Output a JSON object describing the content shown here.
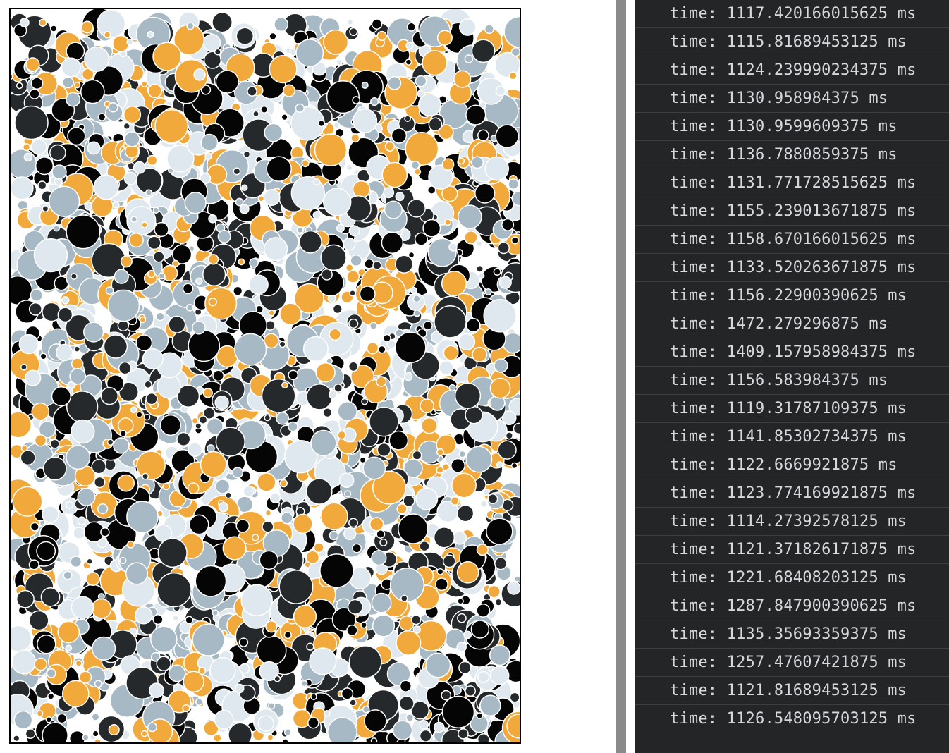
{
  "canvas": {
    "colors": [
      "#f2a93b",
      "#a7b9c4",
      "#dfe8ee",
      "#25292b",
      "#050505"
    ],
    "stroke_color": "#ffffff",
    "background": "#ffffff"
  },
  "console": {
    "background": "#232527",
    "text_color": "#d6d9dc",
    "entries": [
      "time: 1117.420166015625 ms",
      "time: 1115.81689453125 ms",
      "time: 1124.239990234375 ms",
      "time: 1130.958984375 ms",
      "time: 1130.9599609375 ms",
      "time: 1136.7880859375 ms",
      "time: 1131.771728515625 ms",
      "time: 1155.239013671875 ms",
      "time: 1158.670166015625 ms",
      "time: 1133.520263671875 ms",
      "time: 1156.22900390625 ms",
      "time: 1472.279296875 ms",
      "time: 1409.157958984375 ms",
      "time: 1156.583984375 ms",
      "time: 1119.31787109375 ms",
      "time: 1141.85302734375 ms",
      "time: 1122.6669921875 ms",
      "time: 1123.774169921875 ms",
      "time: 1114.27392578125 ms",
      "time: 1121.371826171875 ms",
      "time: 1221.68408203125 ms",
      "time: 1287.847900390625 ms",
      "time: 1135.35693359375 ms",
      "time: 1257.47607421875 ms",
      "time: 1121.81689453125 ms",
      "time: 1126.548095703125 ms"
    ]
  }
}
